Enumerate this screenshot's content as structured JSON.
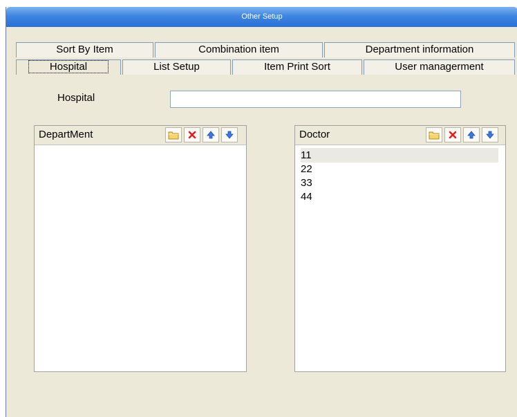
{
  "window": {
    "title": "Other Setup"
  },
  "tabs_row1": [
    {
      "label": "Sort By Item"
    },
    {
      "label": "Combination item"
    },
    {
      "label": "Department information"
    }
  ],
  "tabs_row2": [
    {
      "label": "Hospital",
      "active": true
    },
    {
      "label": "List Setup"
    },
    {
      "label": "Item Print Sort"
    },
    {
      "label": "User managerment"
    }
  ],
  "hospital": {
    "label": "Hospital",
    "value": ""
  },
  "department": {
    "title": "DepartMent",
    "items": []
  },
  "doctor": {
    "title": "Doctor",
    "items": [
      "11",
      "22",
      "33",
      "44"
    ],
    "selected_index": 0
  },
  "toolbar_icons": [
    "folder-icon",
    "delete-icon",
    "move-up-icon",
    "move-down-icon"
  ]
}
